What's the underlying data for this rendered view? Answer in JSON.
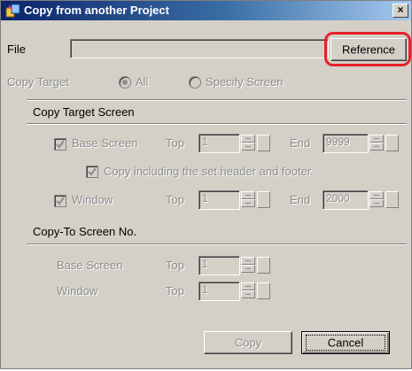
{
  "window": {
    "title": "Copy from another Project",
    "close_label": "×"
  },
  "file": {
    "label": "File",
    "value": "",
    "reference_button": "Reference"
  },
  "copy_target": {
    "label": "Copy Target",
    "option_all": "All",
    "option_specify": "Specify Screen",
    "selected": "All"
  },
  "copy_target_screen": {
    "heading": "Copy Target Screen",
    "base_screen": {
      "label": "Base Screen",
      "checked": true,
      "top_label": "Top",
      "top_value": "1",
      "end_label": "End",
      "end_value": "9999"
    },
    "include_header": {
      "label": "Copy including the set header and footer.",
      "checked": true
    },
    "window": {
      "label": "Window",
      "checked": true,
      "top_label": "Top",
      "top_value": "1",
      "end_label": "End",
      "end_value": "2000"
    }
  },
  "copy_to": {
    "heading": "Copy-To Screen No.",
    "base_screen": {
      "label": "Base Screen",
      "top_label": "Top",
      "top_value": "1"
    },
    "window": {
      "label": "Window",
      "top_label": "Top",
      "top_value": "1"
    }
  },
  "buttons": {
    "copy": "Copy",
    "cancel": "Cancel"
  },
  "colors": {
    "title_bar_start": "#0a246a",
    "title_bar_end": "#a6caf0",
    "dialog_bg": "#d4d0c8",
    "annotation": "#e8202a"
  }
}
